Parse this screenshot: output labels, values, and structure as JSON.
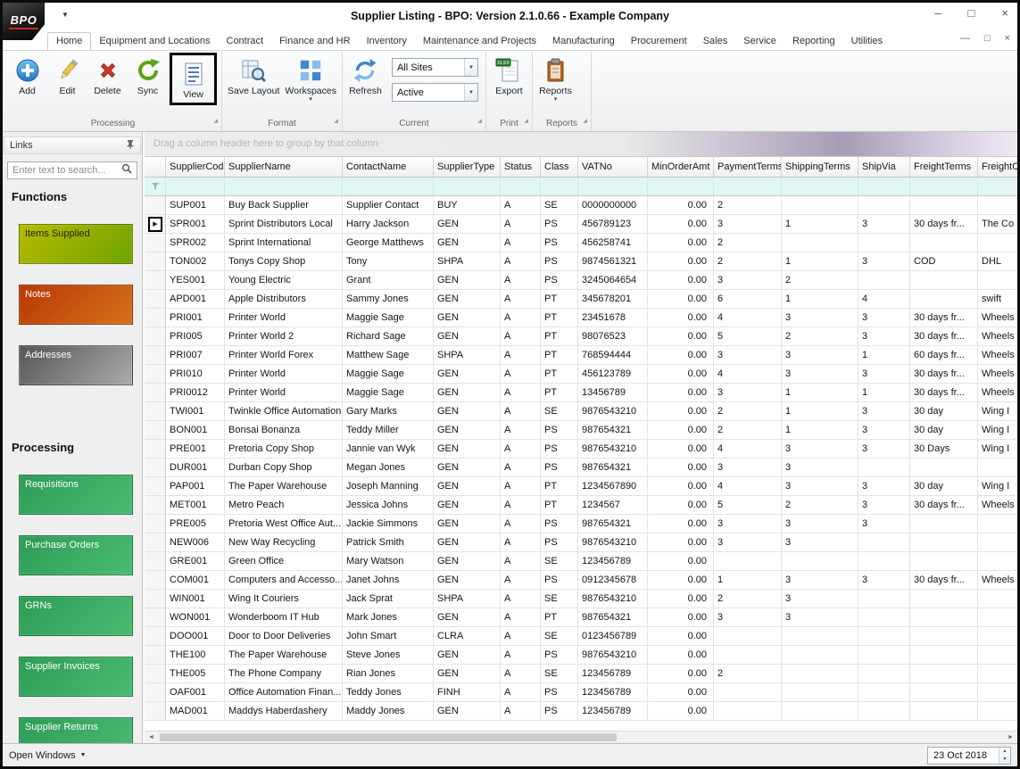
{
  "window": {
    "title": "Supplier Listing - BPO: Version 2.1.0.66 - Example Company",
    "logo": "BPO",
    "controls": {
      "minimize": "–",
      "maximize": "□",
      "close": "×"
    }
  },
  "ribbon": {
    "tabs": [
      "Home",
      "Equipment and Locations",
      "Contract",
      "Finance and HR",
      "Inventory",
      "Maintenance and Projects",
      "Manufacturing",
      "Procurement",
      "Sales",
      "Service",
      "Reporting",
      "Utilities"
    ],
    "active_tab": "Home",
    "groups": {
      "processing": {
        "label": "Processing",
        "add": "Add",
        "edit": "Edit",
        "delete": "Delete",
        "sync": "Sync",
        "view": "View"
      },
      "format": {
        "label": "Format",
        "save_layout": "Save Layout",
        "workspaces": "Workspaces"
      },
      "current": {
        "label": "Current",
        "refresh": "Refresh",
        "site_filter": "All Sites",
        "status_filter": "Active"
      },
      "print": {
        "label": "Print",
        "export": "Export"
      },
      "reports": {
        "label": "Reports",
        "reports": "Reports"
      }
    }
  },
  "sidebar": {
    "title": "Links",
    "search_placeholder": "Enter text to search...",
    "sections": [
      {
        "heading": "Functions",
        "buttons": [
          {
            "label": "Items Supplied",
            "color_from": "#b9ba00",
            "color_to": "#6da300",
            "text_color": "#1d2a00"
          },
          {
            "label": "Notes",
            "color_from": "#b93800",
            "color_to": "#d4711f",
            "text_color": "#ffffff"
          },
          {
            "label": "Addresses",
            "color_from": "#555555",
            "color_to": "#ababab",
            "text_color": "#ffffff"
          }
        ]
      },
      {
        "heading": "Processing",
        "buttons": [
          {
            "label": "Requisitions",
            "color_from": "#2d9c55",
            "color_to": "#4bbb72",
            "text_color": "#ffffff"
          },
          {
            "label": "Purchase Orders",
            "color_from": "#2d9c55",
            "color_to": "#4bbb72",
            "text_color": "#ffffff"
          },
          {
            "label": "GRNs",
            "color_from": "#2d9c55",
            "color_to": "#4bbb72",
            "text_color": "#ffffff"
          },
          {
            "label": "Supplier Invoices",
            "color_from": "#2d9c55",
            "color_to": "#4bbb72",
            "text_color": "#ffffff"
          },
          {
            "label": "Supplier Returns",
            "color_from": "#2d9c55",
            "color_to": "#4bbb72",
            "text_color": "#ffffff"
          }
        ]
      }
    ]
  },
  "grid": {
    "group_hint": "Drag a column header here to group by that column",
    "columns": [
      "SupplierCode",
      "SupplierName",
      "ContactName",
      "SupplierType",
      "Status",
      "Class",
      "VATNo",
      "MinOrderAmt",
      "PaymentTerms",
      "ShippingTerms",
      "ShipVia",
      "FreightTerms",
      "FreightCarrier"
    ],
    "selected_row_index": 1,
    "rows": [
      [
        "SUP001",
        "Buy Back Supplier",
        "Supplier Contact",
        "BUY",
        "A",
        "SE",
        "0000000000",
        "0.00",
        "2",
        "",
        "",
        "",
        ""
      ],
      [
        "SPR001",
        "Sprint Distributors Local",
        "Harry Jackson",
        "GEN",
        "A",
        "PS",
        "456789123",
        "0.00",
        "3",
        "1",
        "3",
        "30 days fr...",
        "The Co"
      ],
      [
        "SPR002",
        "Sprint International",
        "George Matthews",
        "GEN",
        "A",
        "PS",
        "456258741",
        "0.00",
        "2",
        "",
        "",
        "",
        ""
      ],
      [
        "TON002",
        "Tonys Copy Shop",
        "Tony",
        "SHPA",
        "A",
        "PS",
        "9874561321",
        "0.00",
        "2",
        "1",
        "3",
        "COD",
        "DHL"
      ],
      [
        "YES001",
        "Young Electric",
        "Grant",
        "GEN",
        "A",
        "PS",
        "3245064654",
        "0.00",
        "3",
        "2",
        "",
        "",
        ""
      ],
      [
        "APD001",
        "Apple Distributors",
        "Sammy Jones",
        "GEN",
        "A",
        "PT",
        "345678201",
        "0.00",
        "6",
        "1",
        "4",
        "",
        "swift"
      ],
      [
        "PRI001",
        "Printer World",
        "Maggie Sage",
        "GEN",
        "A",
        "PT",
        "23451678",
        "0.00",
        "4",
        "3",
        "3",
        "30 days fr...",
        "Wheels"
      ],
      [
        "PRI005",
        "Printer World 2",
        "Richard Sage",
        "GEN",
        "A",
        "PT",
        "98076523",
        "0.00",
        "5",
        "2",
        "3",
        "30 days fr...",
        "Wheels"
      ],
      [
        "PRI007",
        "Printer World Forex",
        "Matthew Sage",
        "SHPA",
        "A",
        "PT",
        "768594444",
        "0.00",
        "3",
        "3",
        "1",
        "60 days fr...",
        "Wheels"
      ],
      [
        "PRI010",
        "Printer World",
        "Maggie Sage",
        "GEN",
        "A",
        "PT",
        "456123789",
        "0.00",
        "4",
        "3",
        "3",
        "30 days fr...",
        "Wheels"
      ],
      [
        "PRI0012",
        "Printer World",
        "Maggie Sage",
        "GEN",
        "A",
        "PT",
        "13456789",
        "0.00",
        "3",
        "1",
        "1",
        "30 days fr...",
        "Wheels"
      ],
      [
        "TWI001",
        "Twinkle Office Automation",
        "Gary Marks",
        "GEN",
        "A",
        "SE",
        "9876543210",
        "0.00",
        "2",
        "1",
        "3",
        "30 day",
        "Wing I"
      ],
      [
        "BON001",
        "Bonsai Bonanza",
        "Teddy Miller",
        "GEN",
        "A",
        "PS",
        "987654321",
        "0.00",
        "2",
        "1",
        "3",
        "30 day",
        "Wing I"
      ],
      [
        "PRE001",
        "Pretoria Copy Shop",
        "Jannie van Wyk",
        "GEN",
        "A",
        "PS",
        "9876543210",
        "0.00",
        "4",
        "3",
        "3",
        "30 Days",
        "Wing I"
      ],
      [
        "DUR001",
        "Durban Copy Shop",
        "Megan Jones",
        "GEN",
        "A",
        "PS",
        "987654321",
        "0.00",
        "3",
        "3",
        "",
        "",
        ""
      ],
      [
        "PAP001",
        "The Paper Warehouse",
        "Joseph Manning",
        "GEN",
        "A",
        "PT",
        "1234567890",
        "0.00",
        "4",
        "3",
        "3",
        "30 day",
        "Wing I"
      ],
      [
        "MET001",
        "Metro Peach",
        "Jessica Johns",
        "GEN",
        "A",
        "PT",
        "1234567",
        "0.00",
        "5",
        "2",
        "3",
        "30 days fr...",
        "Wheels"
      ],
      [
        "PRE005",
        "Pretoria West Office Aut...",
        "Jackie Simmons",
        "GEN",
        "A",
        "PS",
        "987654321",
        "0.00",
        "3",
        "3",
        "3",
        "",
        ""
      ],
      [
        "NEW006",
        "New Way Recycling",
        "Patrick Smith",
        "GEN",
        "A",
        "PS",
        "9876543210",
        "0.00",
        "3",
        "3",
        "",
        "",
        ""
      ],
      [
        "GRE001",
        "Green Office",
        "Mary Watson",
        "GEN",
        "A",
        "SE",
        "123456789",
        "0.00",
        "",
        "",
        "",
        "",
        ""
      ],
      [
        "COM001",
        "Computers and Accesso...",
        "Janet Johns",
        "GEN",
        "A",
        "PS",
        "0912345678",
        "0.00",
        "1",
        "3",
        "3",
        "30 days fr...",
        "Wheels"
      ],
      [
        "WIN001",
        "Wing It Couriers",
        "Jack Sprat",
        "SHPA",
        "A",
        "SE",
        "9876543210",
        "0.00",
        "2",
        "3",
        "",
        "",
        ""
      ],
      [
        "WON001",
        "Wonderboom IT Hub",
        "Mark Jones",
        "GEN",
        "A",
        "PT",
        "987654321",
        "0.00",
        "3",
        "3",
        "",
        "",
        ""
      ],
      [
        "DOO001",
        "Door to Door Deliveries",
        "John Smart",
        "CLRA",
        "A",
        "SE",
        "0123456789",
        "0.00",
        "",
        "",
        "",
        "",
        ""
      ],
      [
        "THE100",
        "The Paper Warehouse",
        "Steve Jones",
        "GEN",
        "A",
        "PS",
        "9876543210",
        "0.00",
        "",
        "",
        "",
        "",
        ""
      ],
      [
        "THE005",
        "The Phone Company",
        "Rian Jones",
        "GEN",
        "A",
        "SE",
        "123456789",
        "0.00",
        "2",
        "",
        "",
        "",
        ""
      ],
      [
        "OAF001",
        "Office Automation Finan...",
        "Teddy Jones",
        "FINH",
        "A",
        "PS",
        "123456789",
        "0.00",
        "",
        "",
        "",
        "",
        ""
      ],
      [
        "MAD001",
        "Maddys Haberdashery",
        "Maddy Jones",
        "GEN",
        "A",
        "PS",
        "123456789",
        "0.00",
        "",
        "",
        "",
        "",
        ""
      ]
    ]
  },
  "statusbar": {
    "open_windows_label": "Open Windows",
    "date_value": "23 Oct 2018"
  }
}
